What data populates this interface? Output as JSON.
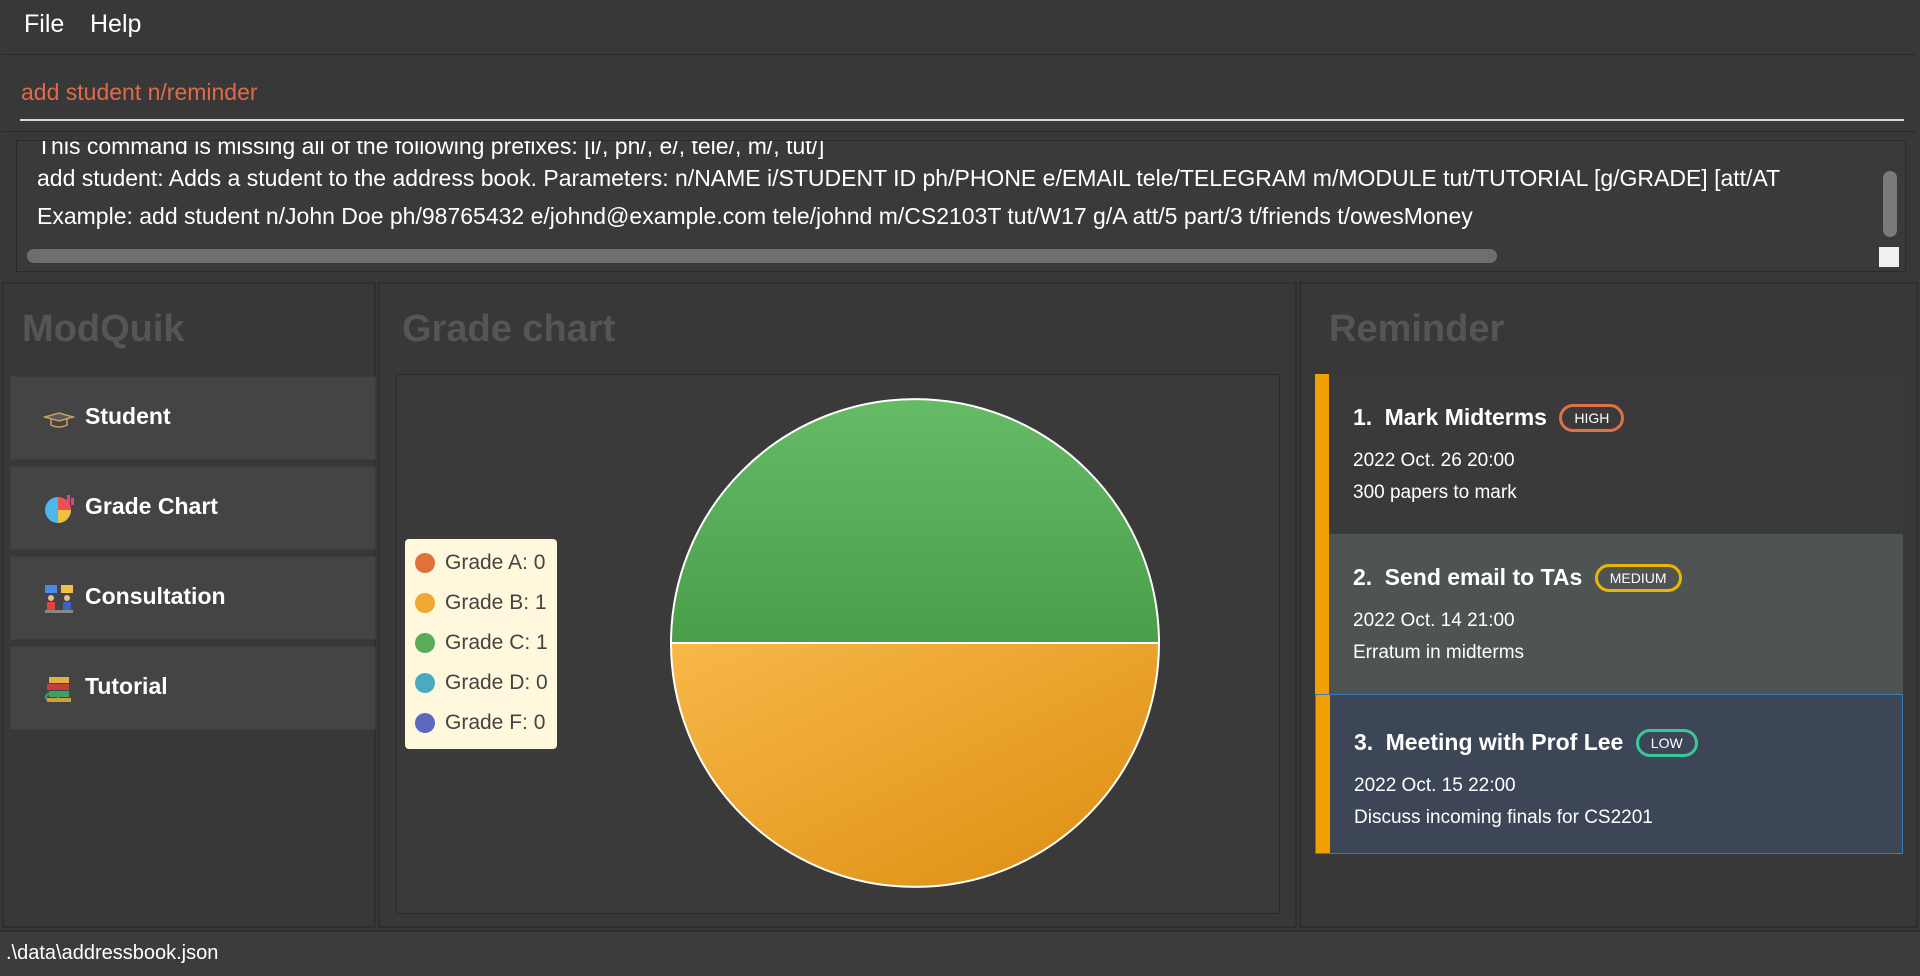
{
  "menu": {
    "file": "File",
    "help": "Help"
  },
  "command": {
    "value": "add student n/reminder"
  },
  "result": {
    "lines": [
      "This command is missing all of the following prefixes: [i/, ph/, e/, tele/, m/, tut/]",
      "add student: Adds a student to the address book. Parameters: n/NAME i/STUDENT ID ph/PHONE e/EMAIL tele/TELEGRAM m/MODULE tut/TUTORIAL [g/GRADE] [att/AT",
      "Example: add student n/John Doe ph/98765432 e/johnd@example.com tele/johnd m/CS2103T tut/W17 g/A att/5 part/3 t/friends t/owesMoney"
    ]
  },
  "sidebar": {
    "title": "ModQuik",
    "items": [
      {
        "label": "Student",
        "icon": "graduation-cap-icon"
      },
      {
        "label": "Grade Chart",
        "icon": "pie-chart-icon"
      },
      {
        "label": "Consultation",
        "icon": "consultation-icon"
      },
      {
        "label": "Tutorial",
        "icon": "books-icon"
      }
    ]
  },
  "chart_panel": {
    "title": "Grade chart"
  },
  "chart_data": {
    "type": "pie",
    "categories": [
      "Grade A",
      "Grade B",
      "Grade C",
      "Grade D",
      "Grade F"
    ],
    "values": [
      0,
      1,
      1,
      0,
      0
    ],
    "legend": [
      "Grade A: 0",
      "Grade B: 1",
      "Grade C: 1",
      "Grade D: 0",
      "Grade F: 0"
    ],
    "colors": [
      "#e2703a",
      "#f0a830",
      "#5aab5a",
      "#4aabc0",
      "#5a68c0"
    ],
    "legend_position": "left"
  },
  "reminder_panel": {
    "title": "Reminder",
    "items": [
      {
        "index": "1.",
        "description": "Mark Midterms",
        "priority": "HIGH",
        "priority_color": "#e07048",
        "datetime": "2022 Oct. 26 20:00",
        "details": "300 papers to mark",
        "bg": "#3a3a3a"
      },
      {
        "index": "2.",
        "description": "Send email to TAs",
        "priority": "MEDIUM",
        "priority_color": "#e8b800",
        "datetime": "2022 Oct. 14 21:00",
        "details": "Erratum in midterms",
        "bg": "#4f5354"
      },
      {
        "index": "3.",
        "description": "Meeting with Prof Lee",
        "priority": "LOW",
        "priority_color": "#38c898",
        "datetime": "2022 Oct. 15 22:00",
        "details": "Discuss incoming finals for CS2201",
        "bg": "#3d4656"
      }
    ]
  },
  "status": {
    "path": ".\\data\\addressbook.json"
  }
}
